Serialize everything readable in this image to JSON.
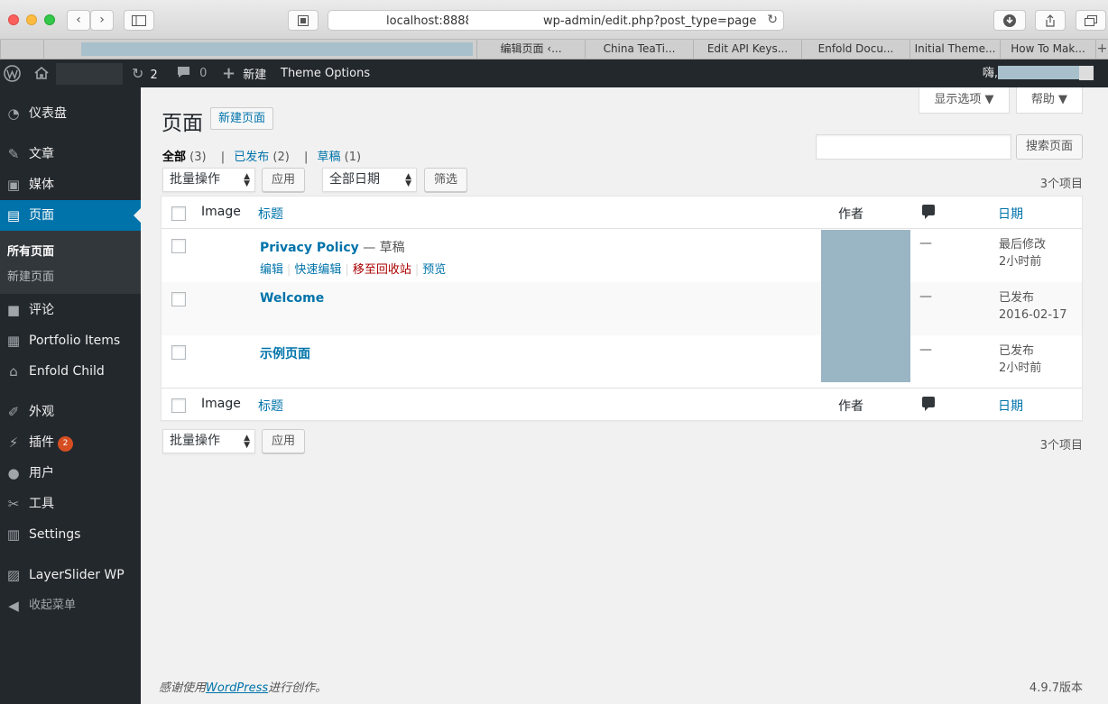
{
  "browser": {
    "url_host": "localhost:8888/",
    "url_path": "wp-admin/edit.php?post_type=page",
    "tabs": [
      "编辑页面 ‹...",
      "China TeaTi...",
      "Edit API Keys...",
      "Enfold Docu...",
      "Initial Theme...",
      "How To Mak..."
    ],
    "tab_plus": "+"
  },
  "adminbar": {
    "updates_count": "2",
    "comments_count": "0",
    "new_label": "新建",
    "theme_options": "Theme Options",
    "greeting": "嗨,"
  },
  "sidebar": {
    "items": [
      {
        "label": "仪表盘",
        "icon": "dashboard-icon",
        "glyph": "◔"
      },
      {
        "label": "文章",
        "icon": "pushpin-icon",
        "glyph": "✎"
      },
      {
        "label": "媒体",
        "icon": "media-icon",
        "glyph": "▣"
      },
      {
        "label": "页面",
        "icon": "page-icon",
        "glyph": "▤"
      },
      {
        "label": "评论",
        "icon": "comment-icon",
        "glyph": "■"
      },
      {
        "label": "Portfolio Items",
        "icon": "portfolio-icon",
        "glyph": "▦"
      },
      {
        "label": "Enfold Child",
        "icon": "home-icon",
        "glyph": "⌂"
      },
      {
        "label": "外观",
        "icon": "brush-icon",
        "glyph": "✐"
      },
      {
        "label": "插件",
        "icon": "plugin-icon",
        "glyph": "⚡",
        "badge": "2"
      },
      {
        "label": "用户",
        "icon": "user-icon",
        "glyph": "●"
      },
      {
        "label": "工具",
        "icon": "wrench-icon",
        "glyph": "✂"
      },
      {
        "label": "Settings",
        "icon": "settings-icon",
        "glyph": "▥"
      },
      {
        "label": "LayerSlider WP",
        "icon": "layerslider-icon",
        "glyph": "▨"
      },
      {
        "label": "收起菜单",
        "icon": "collapse-icon",
        "glyph": "◀"
      }
    ],
    "submenu": [
      "所有页面",
      "新建页面"
    ]
  },
  "screen_options": "显示选项 ▼",
  "help": "帮助 ▼",
  "page_title": "页面",
  "add_new": "新建页面",
  "views": {
    "all": "全部",
    "all_count": "(3)",
    "published": "已发布",
    "published_count": "(2)",
    "draft": "草稿",
    "draft_count": "(1)",
    "sep": "|"
  },
  "search_button": "搜索页面",
  "bulk_actions": "批量操作",
  "apply": "应用",
  "all_dates": "全部日期",
  "filter": "筛选",
  "items_count": "3个项目",
  "columns": {
    "image": "Image",
    "title": "标题",
    "author": "作者",
    "date": "日期"
  },
  "rows": [
    {
      "title": "Privacy Policy",
      "state": " — 草稿",
      "comments": "—",
      "date_status": "最后修改",
      "date_value": "2小时前",
      "actions": {
        "edit": "编辑",
        "quick_edit": "快速编辑",
        "trash": "移至回收站",
        "preview": "预览",
        "sep": "|"
      }
    },
    {
      "title": "Welcome",
      "state": "",
      "comments": "—",
      "date_status": "已发布",
      "date_value": "2016-02-17"
    },
    {
      "title": "示例页面",
      "state": "",
      "comments": "—",
      "date_status": "已发布",
      "date_value": "2小时前"
    }
  ],
  "footer": {
    "thanks_pre": "感谢使用",
    "wordpress": "WordPress",
    "thanks_post": "进行创作。",
    "version": "4.9.7版本"
  },
  "glyphs": {
    "back": "‹",
    "forward": "›",
    "reload": "↻",
    "arrows": "▲▼",
    "plus": "+"
  }
}
